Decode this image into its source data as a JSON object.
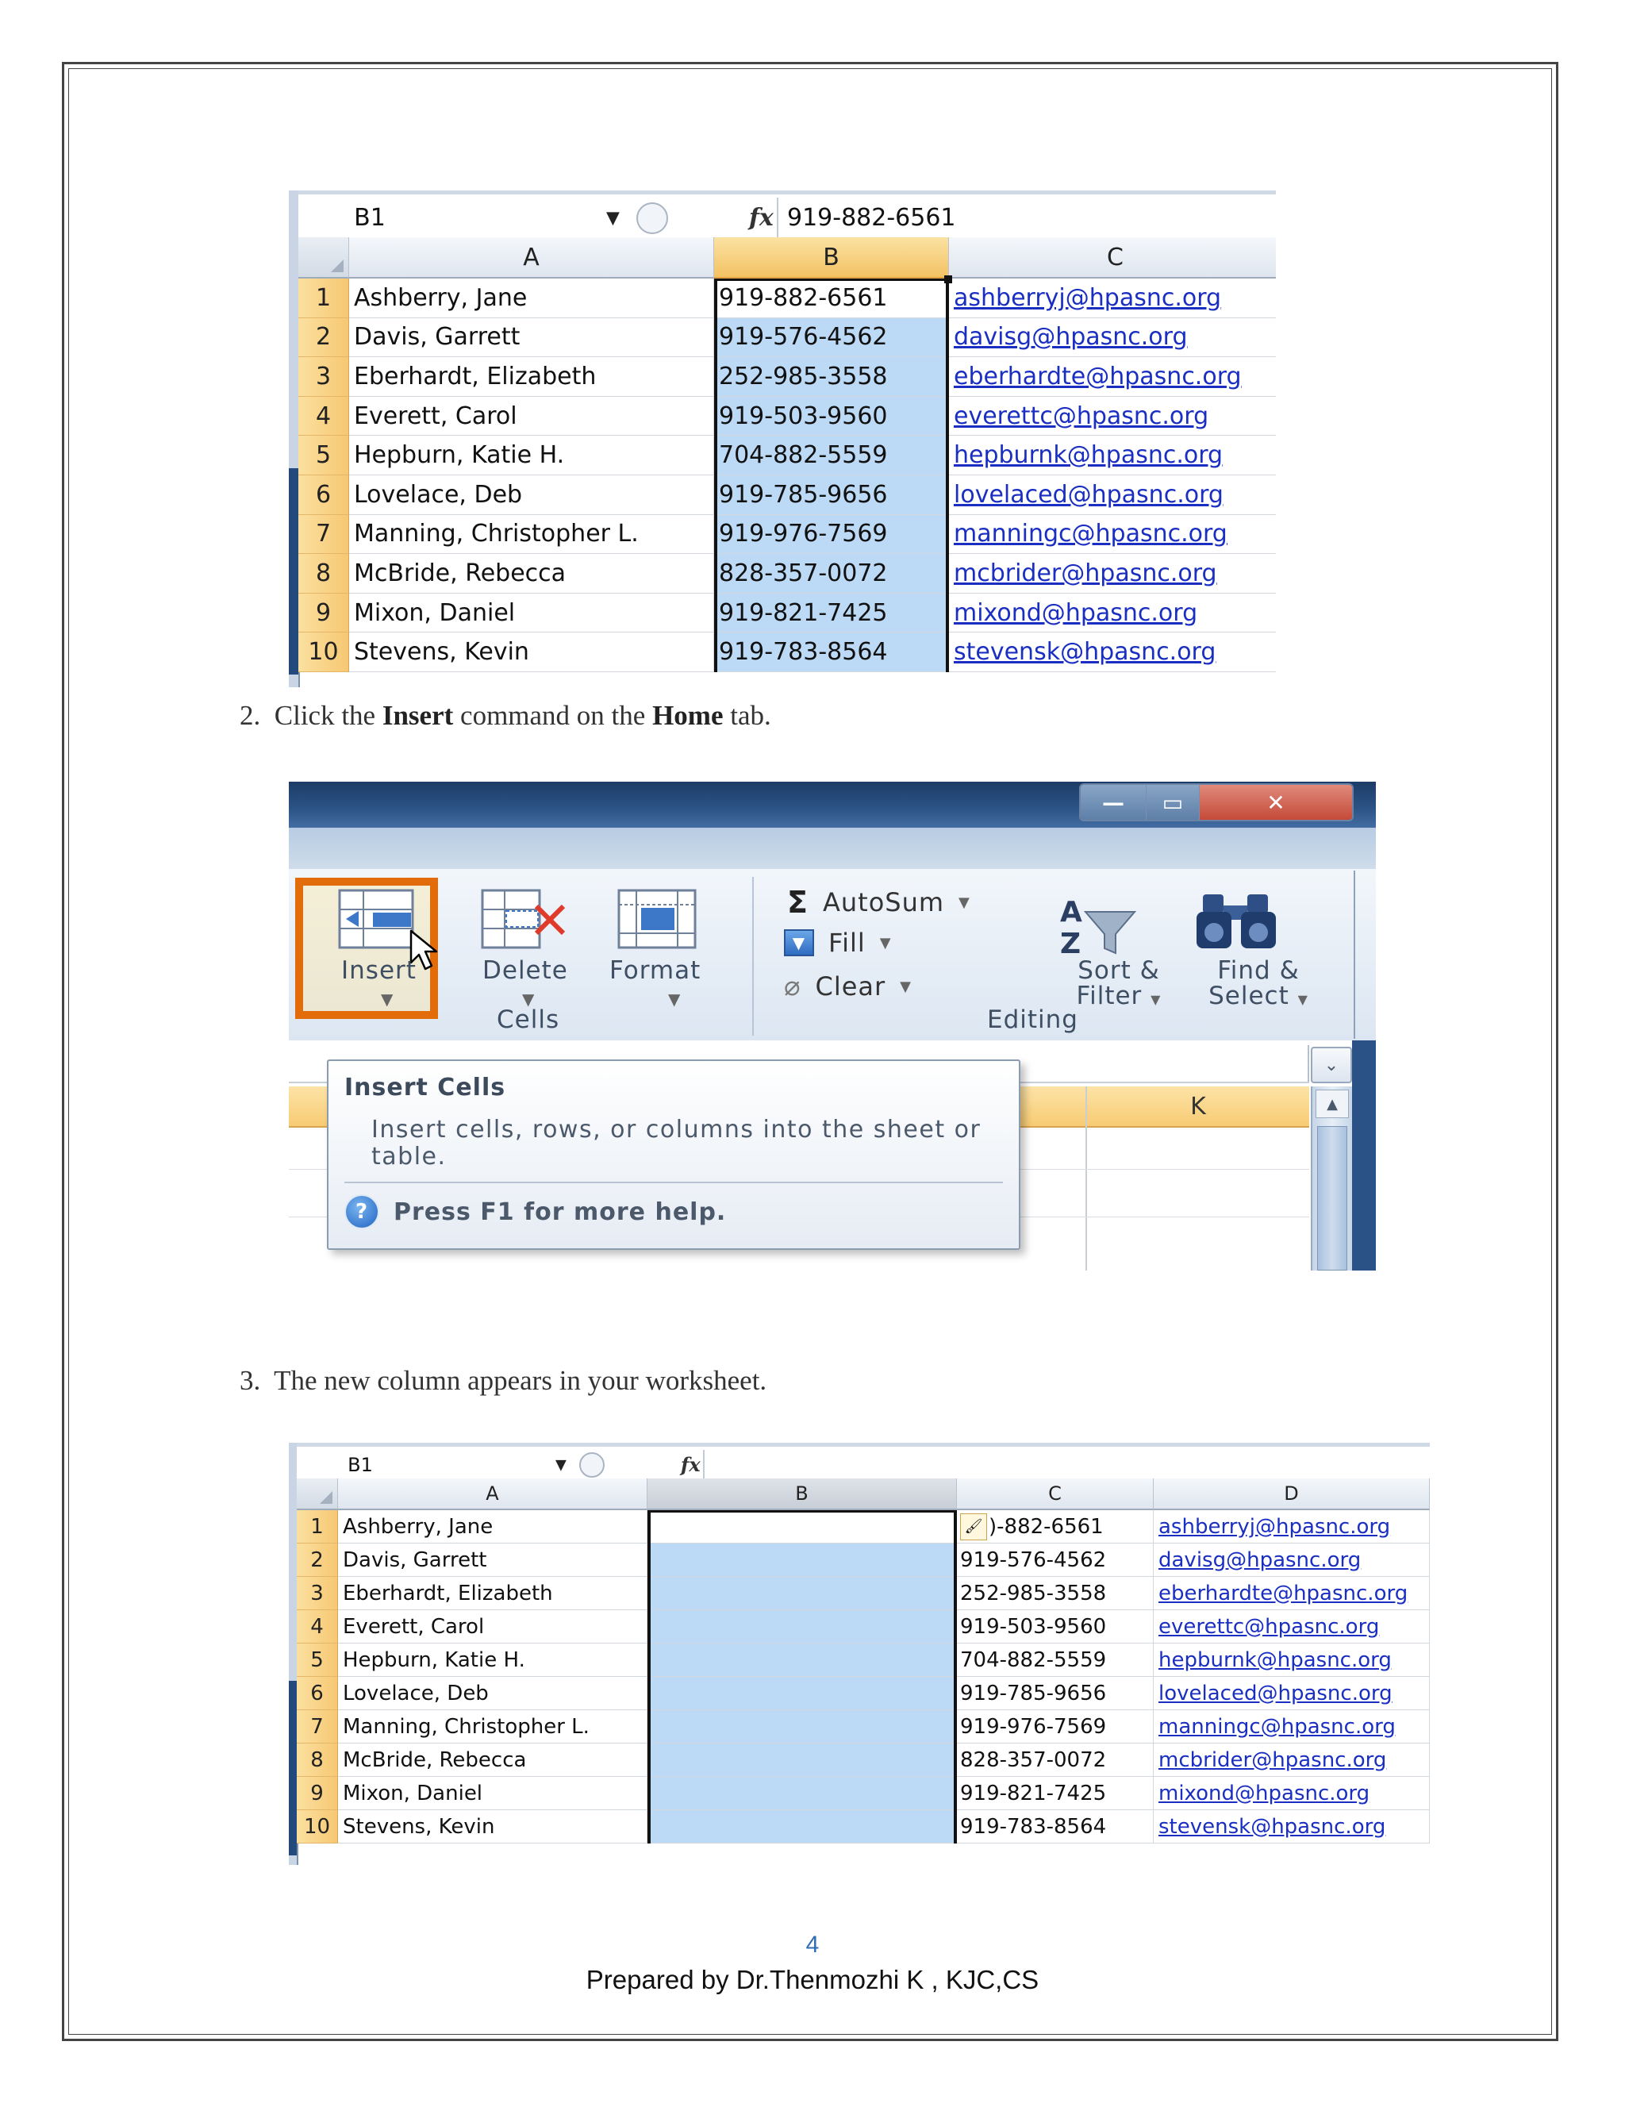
{
  "screenshot1": {
    "name_box": "B1",
    "fx": "fx",
    "formula_value": "919-882-6561",
    "columns": [
      "A",
      "B",
      "C"
    ],
    "rows": [
      {
        "n": "1",
        "a": "Ashberry, Jane",
        "b": "919-882-6561",
        "c": "ashberryj@hpasnc.org"
      },
      {
        "n": "2",
        "a": "Davis, Garrett",
        "b": "919-576-4562",
        "c": "davisg@hpasnc.org"
      },
      {
        "n": "3",
        "a": "Eberhardt, Elizabeth",
        "b": "252-985-3558",
        "c": "eberhardte@hpasnc.org"
      },
      {
        "n": "4",
        "a": "Everett, Carol",
        "b": "919-503-9560",
        "c": "everettc@hpasnc.org"
      },
      {
        "n": "5",
        "a": "Hepburn, Katie H.",
        "b": "704-882-5559",
        "c": "hepburnk@hpasnc.org"
      },
      {
        "n": "6",
        "a": "Lovelace, Deb",
        "b": "919-785-9656",
        "c": "lovelaced@hpasnc.org"
      },
      {
        "n": "7",
        "a": "Manning, Christopher L.",
        "b": "919-976-7569",
        "c": "manningc@hpasnc.org"
      },
      {
        "n": "8",
        "a": "McBride, Rebecca",
        "b": "828-357-0072",
        "c": "mcbrider@hpasnc.org"
      },
      {
        "n": "9",
        "a": "Mixon, Daniel",
        "b": "919-821-7425",
        "c": "mixond@hpasnc.org"
      },
      {
        "n": "10",
        "a": "Stevens, Kevin",
        "b": "919-783-8564",
        "c": "stevensk@hpasnc.org"
      }
    ]
  },
  "step2": {
    "num": "2.",
    "pre": "Click the ",
    "bold1": "Insert",
    "mid": " command on the ",
    "bold2": "Home",
    "post": " tab."
  },
  "ribbon": {
    "cells_buttons": [
      {
        "label": "Insert"
      },
      {
        "label": "Delete"
      },
      {
        "label": "Format"
      }
    ],
    "cells_group": "Cells",
    "autosum": "AutoSum",
    "fill": "Fill",
    "clear": "Clear",
    "sort_filter": [
      "Sort &",
      "Filter"
    ],
    "find_select": [
      "Find &",
      "Select"
    ],
    "editing_group": "Editing",
    "column_k": "K",
    "tooltip": {
      "title": "Insert Cells",
      "body": "Insert cells, rows, or columns into the sheet or table.",
      "help": "Press F1 for more help."
    }
  },
  "step3": {
    "num": "3.",
    "text": "The new column appears in your worksheet."
  },
  "screenshot2": {
    "name_box": "B1",
    "fx": "fx",
    "columns": [
      "A",
      "B",
      "C",
      "D"
    ],
    "first_phone": ")-882-6561",
    "rows": [
      {
        "n": "1",
        "a": "Ashberry, Jane",
        "c": "919-882-6561",
        "d": "ashberryj@hpasnc.org"
      },
      {
        "n": "2",
        "a": "Davis, Garrett",
        "c": "919-576-4562",
        "d": "davisg@hpasnc.org"
      },
      {
        "n": "3",
        "a": "Eberhardt, Elizabeth",
        "c": "252-985-3558",
        "d": "eberhardte@hpasnc.org"
      },
      {
        "n": "4",
        "a": "Everett, Carol",
        "c": "919-503-9560",
        "d": "everettc@hpasnc.org"
      },
      {
        "n": "5",
        "a": "Hepburn, Katie H.",
        "c": "704-882-5559",
        "d": "hepburnk@hpasnc.org"
      },
      {
        "n": "6",
        "a": "Lovelace, Deb",
        "c": "919-785-9656",
        "d": "lovelaced@hpasnc.org"
      },
      {
        "n": "7",
        "a": "Manning, Christopher L.",
        "c": "919-976-7569",
        "d": "manningc@hpasnc.org"
      },
      {
        "n": "8",
        "a": "McBride, Rebecca",
        "c": "828-357-0072",
        "d": "mcbrider@hpasnc.org"
      },
      {
        "n": "9",
        "a": "Mixon, Daniel",
        "c": "919-821-7425",
        "d": "mixond@hpasnc.org"
      },
      {
        "n": "10",
        "a": "Stevens, Kevin",
        "c": "919-783-8564",
        "d": "stevensk@hpasnc.org"
      }
    ]
  },
  "footer": {
    "page_number": "4",
    "credit": "Prepared by  Dr.Thenmozhi K , KJC,CS"
  },
  "colors": {
    "selection": "#bcd9f5",
    "row_header": "#f6c873",
    "link": "#1a2fc2",
    "highlight": "#e36c0a"
  }
}
